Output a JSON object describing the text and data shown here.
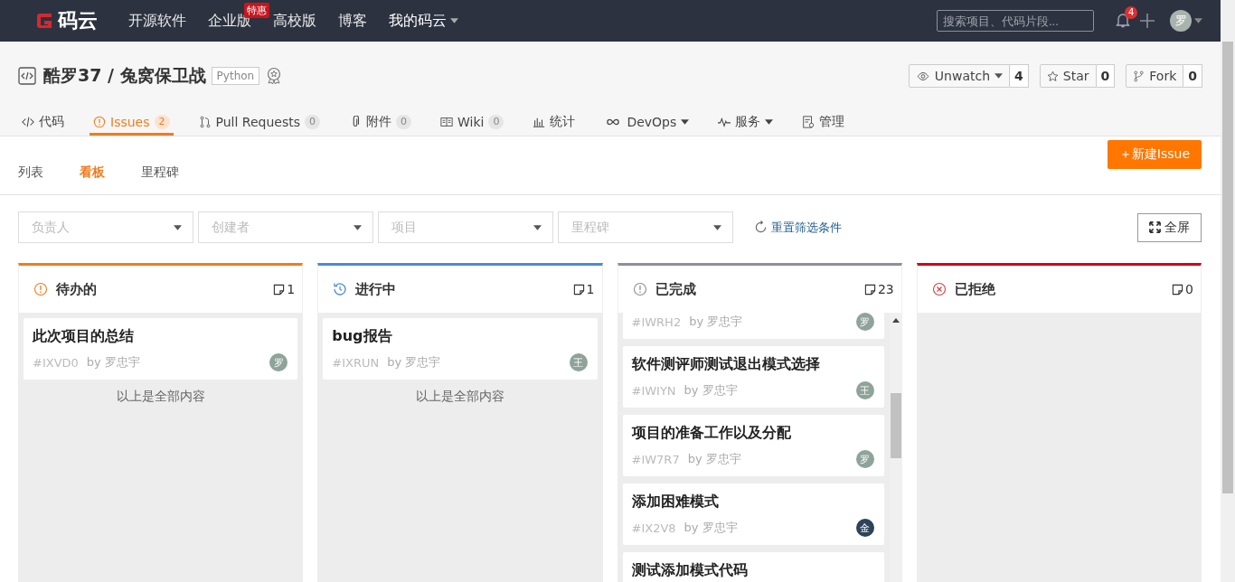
{
  "topbar": {
    "logo": "码云",
    "nav": [
      {
        "label": "开源软件"
      },
      {
        "label": "企业版",
        "badge": "特惠"
      },
      {
        "label": "高校版"
      },
      {
        "label": "博客"
      },
      {
        "label": "我的码云",
        "dropdown": true
      }
    ],
    "search": {
      "placeholder": "搜索项目、代码片段..."
    },
    "notifications": "4",
    "avatar": "罗"
  },
  "repo": {
    "owner": "酷罗37",
    "separator": "/",
    "name": "兔窝保卫战",
    "language": "Python",
    "actions": [
      {
        "kind": "watch",
        "label": "Unwatch",
        "count": "4"
      },
      {
        "kind": "star",
        "label": "Star",
        "count": "0"
      },
      {
        "kind": "fork",
        "label": "Fork",
        "count": "0"
      }
    ],
    "tabs": [
      {
        "kind": "code",
        "label": "代码",
        "selected": false
      },
      {
        "kind": "issues",
        "label": "Issues",
        "count": "2",
        "selected": true
      },
      {
        "kind": "pr",
        "label": "Pull Requests",
        "count": "0",
        "selected": false
      },
      {
        "kind": "attach",
        "label": "附件",
        "count": "0",
        "selected": false
      },
      {
        "kind": "wiki",
        "label": "Wiki",
        "count": "0",
        "selected": false
      },
      {
        "kind": "stats",
        "label": "统计",
        "selected": false
      },
      {
        "kind": "devops",
        "label": "DevOps",
        "dropdown": true,
        "selected": false
      },
      {
        "kind": "service",
        "label": "服务",
        "dropdown": true,
        "selected": false
      },
      {
        "kind": "manage",
        "label": "管理",
        "selected": false
      }
    ]
  },
  "views": [
    {
      "label": "列表",
      "selected": false
    },
    {
      "label": "看板",
      "selected": true
    },
    {
      "label": "里程碑",
      "selected": false
    }
  ],
  "new_issue_button": "＋新建Issue",
  "filters": [
    {
      "placeholder": "负责人"
    },
    {
      "placeholder": "创建者"
    },
    {
      "placeholder": "项目"
    },
    {
      "placeholder": "里程碑"
    }
  ],
  "reset_filters": "重置筛选条件",
  "fullscreen_button": "全屏",
  "columns": [
    {
      "kind": "todo",
      "title": "待办的",
      "count": "1",
      "color": "#f37b1d",
      "end_note": "以上是全部内容",
      "cards": [
        {
          "title": "此次项目的总结",
          "id": "#IXVD0",
          "author": "by 罗忠宇",
          "avatar": "罗",
          "color": "#8fa39a"
        }
      ]
    },
    {
      "kind": "progress",
      "title": "进行中",
      "count": "1",
      "color": "#4a8ad8",
      "end_note": "以上是全部内容",
      "cards": [
        {
          "title": "bug报告",
          "id": "#IXRUN",
          "author": "by 罗忠宇",
          "avatar": "王",
          "color": "#8fa39a"
        }
      ]
    },
    {
      "kind": "done",
      "title": "已完成",
      "count": "23",
      "color": "#8e8e9e",
      "scrollbar": true,
      "cards": [
        {
          "id": "#IWRH2",
          "author": "by 罗忠宇",
          "avatar": "罗",
          "color": "#8fa39a"
        },
        {
          "title": "软件测评师测试退出模式选择",
          "id": "#IWIYN",
          "author": "by 罗忠宇",
          "avatar": "王",
          "color": "#8fa39a"
        },
        {
          "title": "项目的准备工作以及分配",
          "id": "#IW7R7",
          "author": "by 罗忠宇",
          "avatar": "罗",
          "color": "#8fa39a"
        },
        {
          "title": "添加困难模式",
          "id": "#IX2V8",
          "author": "by 罗忠宇",
          "avatar": "金",
          "color": "#2e4259"
        },
        {
          "title": "测试添加模式代码"
        }
      ]
    },
    {
      "kind": "rejected",
      "title": "已拒绝",
      "count": "0",
      "color": "#d0021b"
    }
  ]
}
